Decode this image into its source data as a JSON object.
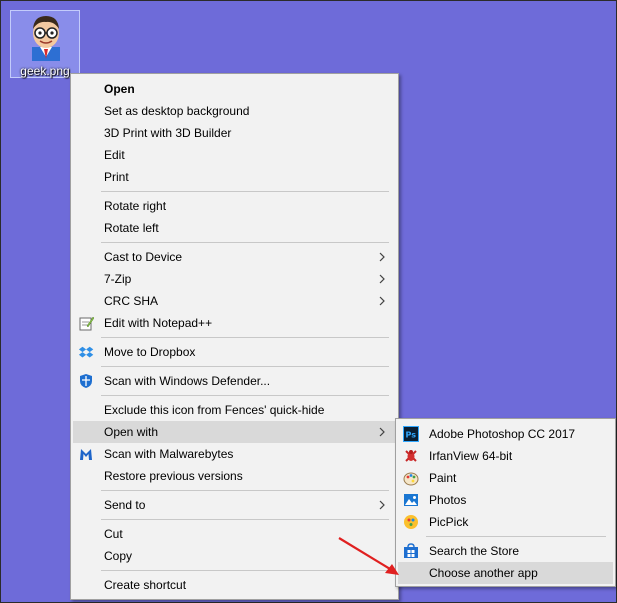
{
  "desktop": {
    "icon_label": "geek.png"
  },
  "context_menu": {
    "items": [
      "Open",
      "Set as desktop background",
      "3D Print with 3D Builder",
      "Edit",
      "Print",
      "Rotate right",
      "Rotate left",
      "Cast to Device",
      "7-Zip",
      "CRC SHA",
      "Edit with Notepad++",
      "Move to Dropbox",
      "Scan with Windows Defender...",
      "Exclude this icon from Fences' quick-hide",
      "Open with",
      "Scan with Malwarebytes",
      "Restore previous versions",
      "Send to",
      "Cut",
      "Copy",
      "Create shortcut"
    ]
  },
  "open_with_menu": {
    "items": [
      "Adobe Photoshop CC 2017",
      "IrfanView 64-bit",
      "Paint",
      "Photos",
      "PicPick",
      "Search the Store",
      "Choose another app"
    ]
  },
  "colors": {
    "desktop_background": "#6e6bd9",
    "menu_background": "#f2f2f2",
    "hover": "#d9d9d9",
    "annotation_arrow": "#e02020"
  },
  "icons": {
    "notepadpp": "notepad-plus-plus-icon",
    "dropbox": "dropbox-icon",
    "defender": "windows-defender-icon",
    "malwarebytes": "malwarebytes-icon",
    "photoshop": "photoshop-icon",
    "irfanview": "irfanview-icon",
    "paint": "paint-icon",
    "photos": "photos-icon",
    "picpick": "picpick-icon",
    "store": "store-icon"
  }
}
